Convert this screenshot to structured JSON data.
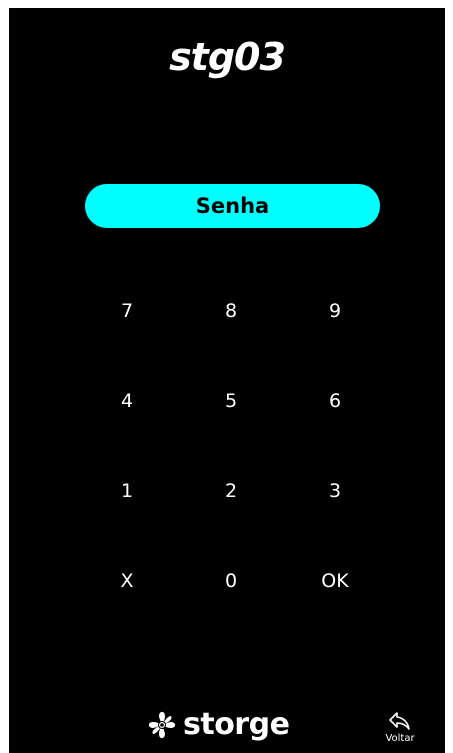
{
  "header": {
    "device_name": "stg03"
  },
  "password_field": {
    "label": "Senha"
  },
  "keypad": {
    "keys": [
      "7",
      "8",
      "9",
      "4",
      "5",
      "6",
      "1",
      "2",
      "3",
      "X",
      "0",
      "OK"
    ]
  },
  "footer": {
    "brand": "storge",
    "brand_icon": "fan-icon",
    "back_label": "Voltar",
    "back_icon": "return-arrow-icon"
  },
  "colors": {
    "background": "#000000",
    "accent": "#00ffff",
    "text": "#ffffff"
  }
}
